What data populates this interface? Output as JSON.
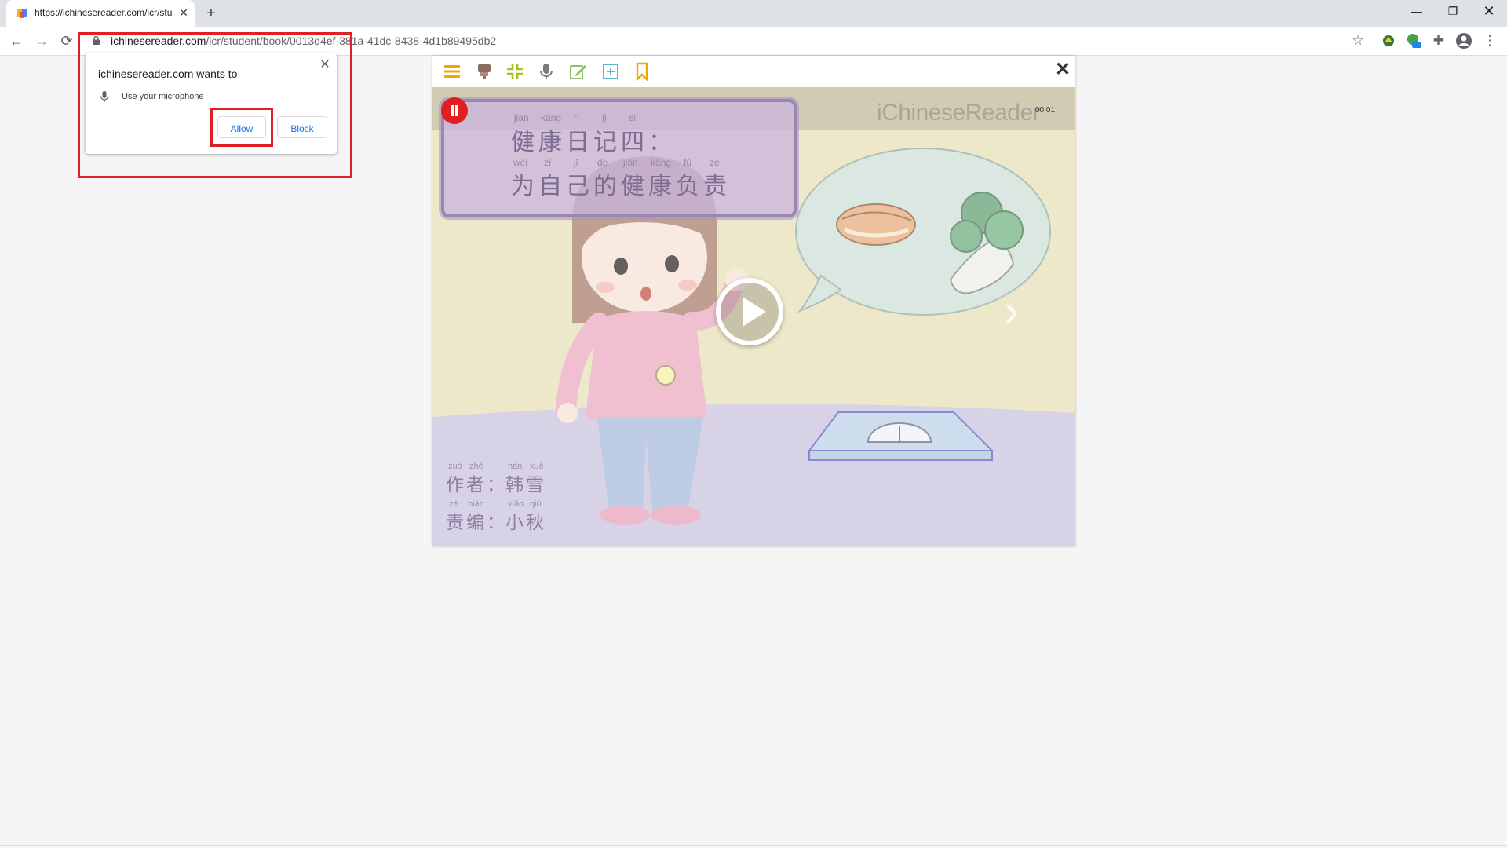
{
  "tab": {
    "title": "https://ichinesereader.com/icr/stu"
  },
  "address": {
    "host": "ichinesereader.com",
    "path": "/icr/student/book/0013d4ef-381a-41dc-8438-4d1b89495db2"
  },
  "permission": {
    "title": "ichinesereader.com wants to",
    "request": "Use your microphone",
    "allow_label": "Allow",
    "block_label": "Block"
  },
  "player": {
    "brand": "iChineseReader",
    "timer": "00:01"
  },
  "book": {
    "title_line1": {
      "pinyin": [
        "jiàn",
        "kāng",
        "rì",
        "jì",
        "sì"
      ],
      "hanzi": "健康日记四："
    },
    "title_line2": {
      "pinyin": [
        "wèi",
        "zì",
        "jǐ",
        "de",
        "jiàn",
        "kāng",
        "fù",
        "zé"
      ],
      "hanzi": "为自己的健康负责"
    },
    "author": {
      "pinyin": [
        "zuò",
        "zhě",
        "hán",
        "xuě"
      ],
      "label": "作者：",
      "name": "韩雪"
    },
    "editor": {
      "pinyin": [
        "zé",
        "biān",
        "xiǎo",
        "qiū"
      ],
      "label": "责编：",
      "name": "小秋"
    }
  },
  "colors": {
    "highlight": "#e21f26",
    "accent": "#f0a800",
    "pause": "#e31e1e"
  }
}
